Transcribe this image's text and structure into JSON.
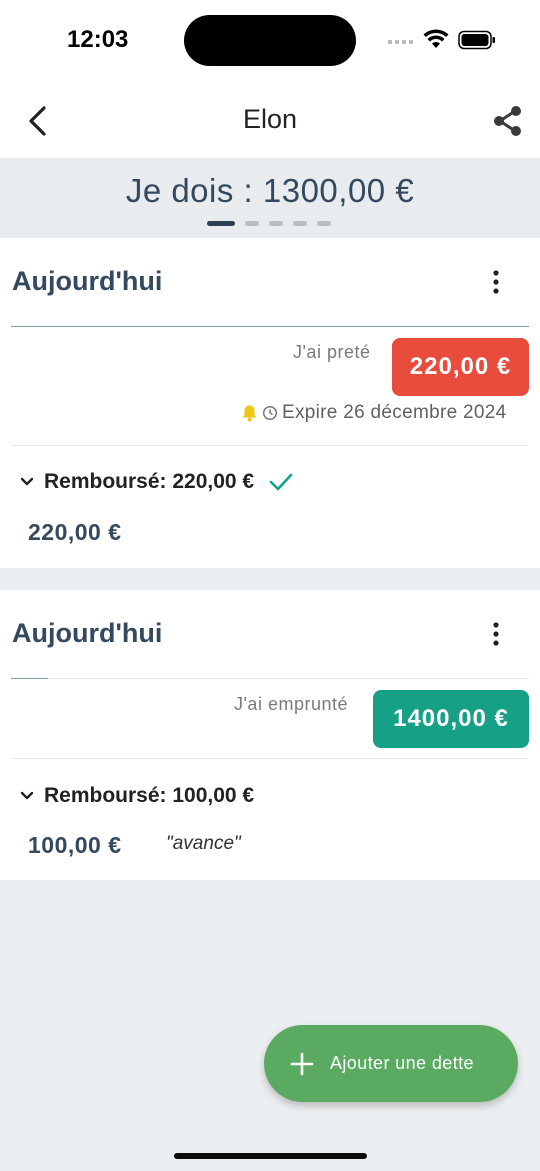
{
  "status_bar": {
    "time": "12:03"
  },
  "nav": {
    "title": "Elon"
  },
  "summary": {
    "text": "Je dois : 1300,00 €",
    "pages": 5,
    "active_page": 1
  },
  "entries": [
    {
      "date": "Aujourd'hui",
      "label": "J'ai preté",
      "amount": "220,00 €",
      "amount_color": "#e74c3c",
      "expire": "Expire 26 décembre 2024",
      "repaid_label": "Remboursé: 220,00 €",
      "repaid_complete": true,
      "repayments": [
        {
          "amount": "220,00 €",
          "note": ""
        }
      ]
    },
    {
      "date": "Aujourd'hui",
      "label": "J'ai emprunté",
      "amount": "1400,00 €",
      "amount_color": "#16a085",
      "repaid_label": "Remboursé: 100,00 €",
      "repaid_complete": false,
      "repayments": [
        {
          "amount": "100,00 €",
          "note": "\"avance\""
        }
      ]
    }
  ],
  "fab": {
    "label": "Ajouter une dette"
  },
  "icons": [
    "back-icon",
    "share-icon",
    "kebab-menu-icon",
    "bell-icon",
    "clock-icon",
    "chevron-down-icon",
    "check-icon",
    "plus-icon",
    "wifi-icon",
    "battery-icon"
  ],
  "colors": {
    "accent_green": "#5aab61",
    "debit_red": "#e74c3c",
    "credit_teal": "#16a085",
    "text_dark": "#34495e"
  }
}
